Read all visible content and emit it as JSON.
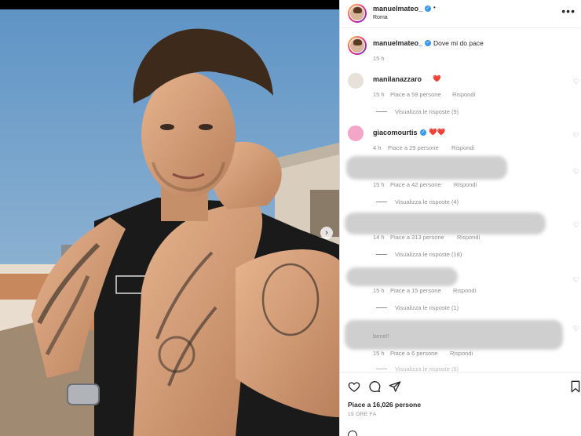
{
  "post": {
    "carousel_arrow": "›",
    "dots": 2,
    "active_dot": 0
  },
  "header": {
    "username": "manuelmateo_",
    "verified_mark": "✓",
    "dot": "•",
    "location": "Roma",
    "more": "•••"
  },
  "caption": {
    "username": "manuelmateo_",
    "text": "Dove mi do pace",
    "time": "15 h"
  },
  "comments": [
    {
      "username": "manilanazzaro",
      "text": "❤️",
      "time": "15 h",
      "likes": "Piace a 59 persone",
      "reply": "Rispondi",
      "replies": "Visualizza le risposte (9)"
    },
    {
      "username": "giacomourtis",
      "text": "❤️❤️",
      "time": "4 h",
      "likes": "Piace a 29 persone",
      "reply": "Rispondi"
    },
    {
      "time": "15 h",
      "likes": "Piace a 42 persone",
      "reply": "Rispondi",
      "replies": "Visualizza le risposte (4)"
    },
    {
      "time": "14 h",
      "likes": "Piace a 313 persone",
      "reply": "Rispondi",
      "replies": "Visualizza le risposte (18)"
    },
    {
      "time": "15 h",
      "likes": "Piace a 15 persone",
      "reply": "Rispondi",
      "replies": "Visualizza le risposte (1)"
    },
    {
      "partial_text": "bene!!",
      "time": "15 h",
      "likes": "Piace a 6 persone",
      "reply": "Rispondi",
      "replies": "Visualizza le risposte (6)"
    }
  ],
  "footer": {
    "likes": "Piace a 16,026 persone",
    "time": "15 ORE FA"
  },
  "colors": {
    "accent": "#3897f0",
    "text": "#262626",
    "muted": "#8e8e8e",
    "heart": "#ed4956"
  }
}
